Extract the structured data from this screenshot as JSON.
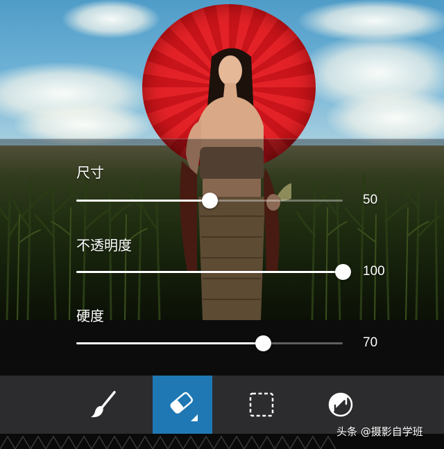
{
  "settings": {
    "size": {
      "label": "尺寸",
      "value": "50",
      "level": 50
    },
    "opacity": {
      "label": "不透明度",
      "value": "100",
      "level": 100
    },
    "hardness": {
      "label": "硬度",
      "value": "70",
      "level": 70
    }
  },
  "toolbar": {
    "tools": [
      {
        "name": "brush-tool",
        "icon": "brush-icon",
        "active": false
      },
      {
        "name": "eraser-tool",
        "icon": "eraser-icon",
        "active": true
      },
      {
        "name": "selection-tool",
        "icon": "dashed-square-icon",
        "active": false
      },
      {
        "name": "invert-tool",
        "icon": "invert-circle-icon",
        "active": false
      }
    ],
    "active_color": "#1f78b4",
    "background_color": "#2c2c2e"
  },
  "watermark": {
    "text": "头条 @摄影自学班"
  },
  "colors": {
    "slider_fill": "#ffffff",
    "slider_track": "rgba(255,255,255,0.35)",
    "umbrella_red": "#e32227"
  }
}
